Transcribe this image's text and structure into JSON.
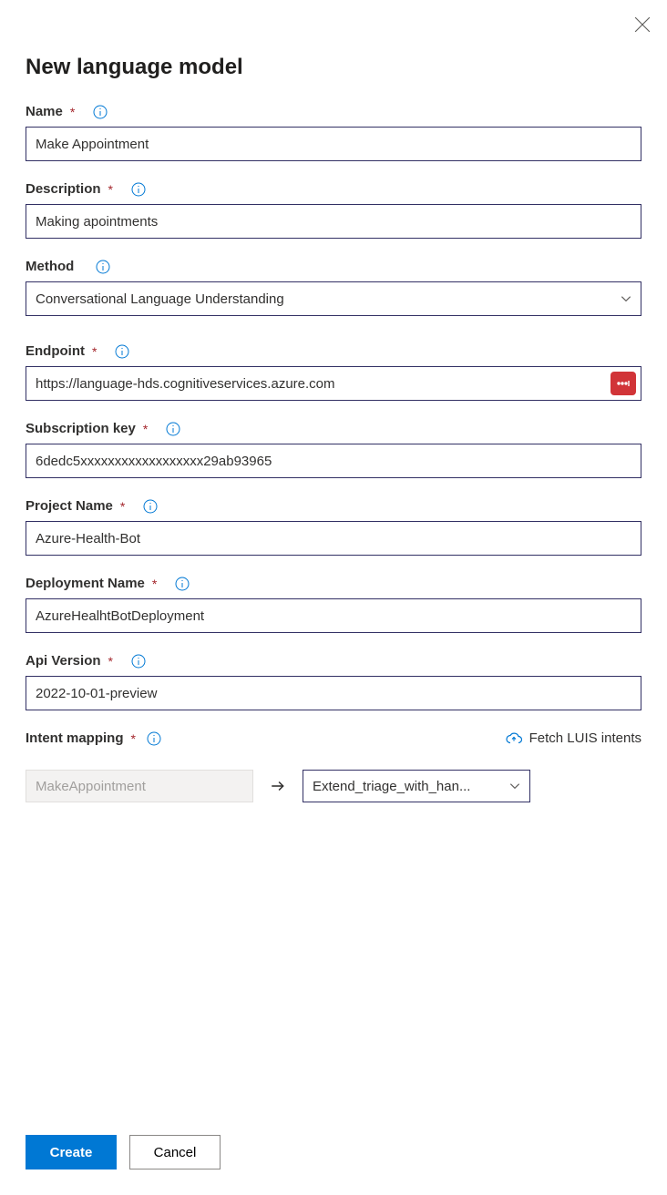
{
  "header": {
    "title": "New language model"
  },
  "fields": {
    "name": {
      "label": "Name",
      "required": true,
      "value": "Make Appointment"
    },
    "description": {
      "label": "Description",
      "required": true,
      "value": "Making apointments"
    },
    "method": {
      "label": "Method",
      "required": false,
      "value": "Conversational Language Understanding"
    },
    "endpoint": {
      "label": "Endpoint",
      "required": true,
      "value": "https://language-hds.cognitiveservices.azure.com"
    },
    "subscription_key": {
      "label": "Subscription key",
      "required": true,
      "value": "6dedc5xxxxxxxxxxxxxxxxxx29ab93965"
    },
    "project_name": {
      "label": "Project Name",
      "required": true,
      "value": "Azure-Health-Bot"
    },
    "deployment_name": {
      "label": "Deployment Name",
      "required": true,
      "value": "AzureHealhtBotDeployment"
    },
    "api_version": {
      "label": "Api Version",
      "required": true,
      "value": "2022-10-01-preview"
    }
  },
  "intent_mapping": {
    "label": "Intent mapping",
    "required": true,
    "fetch_label": "Fetch LUIS intents",
    "source_value": "MakeAppointment",
    "target_value": "Extend_triage_with_han..."
  },
  "footer": {
    "primary": "Create",
    "secondary": "Cancel"
  }
}
